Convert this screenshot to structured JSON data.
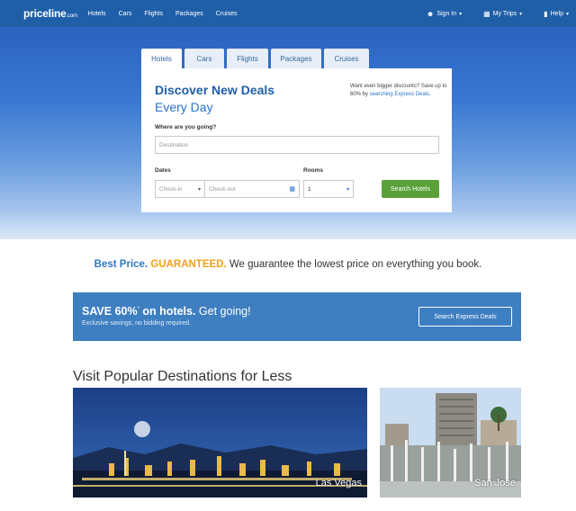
{
  "nav": {
    "logo_main": "priceline",
    "logo_suffix": ".com",
    "links": [
      "Hotels",
      "Cars",
      "Flights",
      "Packages",
      "Cruises"
    ],
    "right": [
      {
        "icon": "user-icon",
        "glyph": "👤",
        "label": "Sign In"
      },
      {
        "icon": "briefcase-icon",
        "glyph": "💼",
        "label": "My Trips"
      },
      {
        "icon": "help-icon",
        "glyph": "💬",
        "label": "Help"
      }
    ]
  },
  "search": {
    "tabs": [
      "Hotels",
      "Cars",
      "Flights",
      "Packages",
      "Cruises"
    ],
    "active_tab": "Hotels",
    "heading": "Discover New Deals",
    "subheading": "Every Day",
    "promo_text": "Want even bigger discounts? Save up to 60% by",
    "promo_link": "searching Express Deals.",
    "destination_label": "Where are you going?",
    "destination_placeholder": "Destination",
    "dates_label": "Dates",
    "checkin_placeholder": "Check-in",
    "checkout_placeholder": "Check-out",
    "rooms_label": "Rooms",
    "rooms_value": "1",
    "search_button": "Search Hotels"
  },
  "guarantee": {
    "part1": "Best Price.",
    "part2": "GUARANTEED.",
    "part3": "We guarantee the lowest price on everything you book."
  },
  "banner": {
    "headline_bold": "SAVE 60%",
    "headline_sup": "*",
    "headline_bold2": " on hotels.",
    "headline_rest": " Get going!",
    "subtext": "Exclusive savings, no bidding required.",
    "button": "Search Express Deals"
  },
  "popular": {
    "title": "Visit Popular Destinations for Less",
    "destinations": [
      {
        "name": "Las Vegas"
      },
      {
        "name": "San Jose"
      }
    ]
  },
  "colors": {
    "nav": "#1f5fa8",
    "accent_blue": "#2a73c8",
    "button_green": "#5aa13a",
    "guarantee_orange": "#f4a017",
    "banner": "#3e7fc1"
  }
}
